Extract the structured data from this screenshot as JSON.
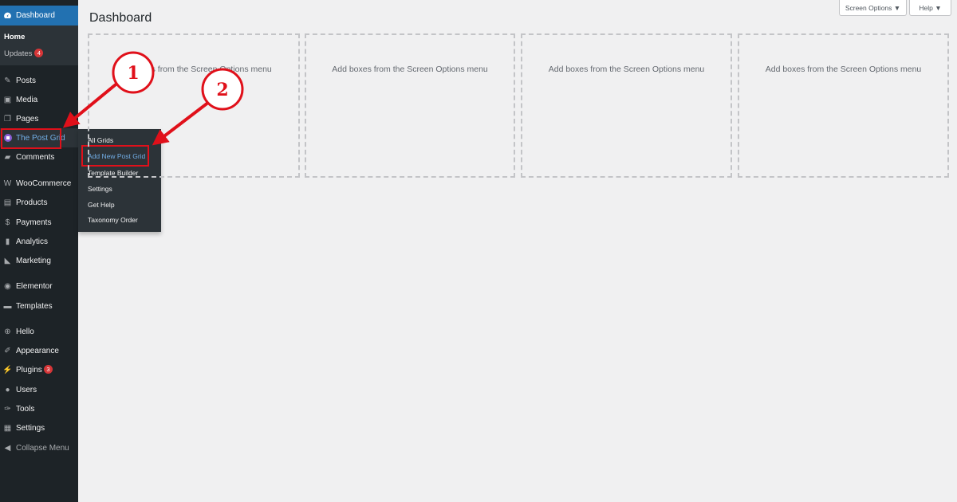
{
  "page": {
    "title": "Dashboard"
  },
  "header": {
    "screen_options": "Screen Options ▼",
    "help": "Help ▼"
  },
  "sidebar": {
    "dashboard": "Dashboard",
    "dashboard_sub": {
      "home": "Home",
      "updates": "Updates",
      "updates_badge": "4"
    },
    "items": [
      {
        "label": "Posts",
        "icon": "pushpin-icon"
      },
      {
        "label": "Media",
        "icon": "media-icon"
      },
      {
        "label": "Pages",
        "icon": "pages-icon"
      },
      {
        "label": "The Post Grid",
        "icon": "post-grid-icon",
        "active": true
      },
      {
        "label": "Comments",
        "icon": "comment-icon"
      },
      {
        "label": "WooCommerce",
        "icon": "woocommerce-icon"
      },
      {
        "label": "Products",
        "icon": "products-icon"
      },
      {
        "label": "Payments",
        "icon": "payments-icon"
      },
      {
        "label": "Analytics",
        "icon": "analytics-icon"
      },
      {
        "label": "Marketing",
        "icon": "megaphone-icon"
      },
      {
        "label": "Elementor",
        "icon": "elementor-icon"
      },
      {
        "label": "Templates",
        "icon": "folder-icon"
      },
      {
        "label": "Hello",
        "icon": "plus-circle-icon"
      },
      {
        "label": "Appearance",
        "icon": "brush-icon"
      },
      {
        "label": "Plugins",
        "icon": "plugin-icon",
        "badge": "3"
      },
      {
        "label": "Users",
        "icon": "user-icon"
      },
      {
        "label": "Tools",
        "icon": "wrench-icon"
      },
      {
        "label": "Settings",
        "icon": "settings-icon"
      },
      {
        "label": "Collapse Menu",
        "icon": "collapse-icon"
      }
    ]
  },
  "flyout": {
    "items": [
      "All Grids",
      "Add New Post Grid",
      "Template Builder",
      "Settings",
      "Get Help",
      "Taxonomy Order"
    ]
  },
  "boxes": {
    "placeholder": "Add boxes from the Screen Options menu"
  },
  "annotations": {
    "marker1": "1",
    "marker2": "2"
  },
  "colors": {
    "sidebar_bg": "#1d2327",
    "accent": "#2271b1",
    "highlight": "#e0101a",
    "link": "#72aee6"
  }
}
